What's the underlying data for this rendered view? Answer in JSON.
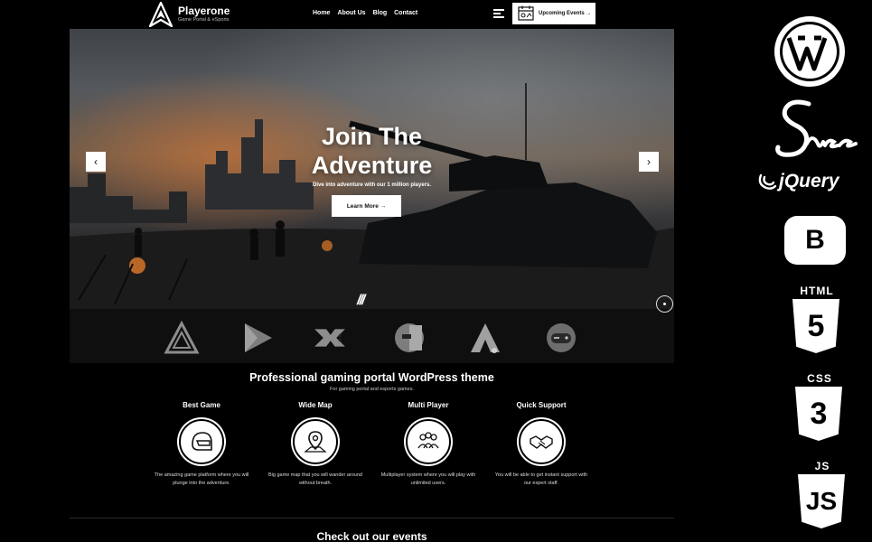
{
  "brand": {
    "name": "Playerone",
    "tagline": "Game Portal & eSports"
  },
  "nav": {
    "items": [
      "Home",
      "About Us",
      "Blog",
      "Contact"
    ]
  },
  "header": {
    "events_button": "Upcoming Events →"
  },
  "hero": {
    "headline_line1": "Join The",
    "headline_line2": "Adventure",
    "subline": "Dive into adventure with our 1 million players.",
    "cta": "Learn More →",
    "prev": "‹",
    "next": "›",
    "slide_marker": "///"
  },
  "partners": [
    "triangle-logo",
    "play-logo",
    "gamepad-x-logo",
    "robot-head-logo",
    "letter-a-logo",
    "controller-badge-logo"
  ],
  "intro": {
    "title": "Professional gaming portal WordPress theme",
    "subtitle": "For gaming portal and esports games.",
    "features": [
      {
        "title": "Best Game",
        "icon": "helmet-icon",
        "desc": "The amazing game platform where you will plunge into the adventure."
      },
      {
        "title": "Wide Map",
        "icon": "map-pin-icon",
        "desc": "Big game map that you will wander around without breath."
      },
      {
        "title": "Multi Player",
        "icon": "group-icon",
        "desc": "Multiplayer system where you will play with unlimited users."
      },
      {
        "title": "Quick Support",
        "icon": "handshake-icon",
        "desc": "You will be able to get instant support with our expert staff."
      }
    ]
  },
  "events": {
    "title": "Check out our events"
  },
  "tech_stack": {
    "jquery": "jQuery",
    "bootstrap": "B",
    "html": "HTML",
    "html_num": "5",
    "css": "CSS",
    "css_num": "3",
    "js": "JS",
    "js_mark": "JS"
  }
}
